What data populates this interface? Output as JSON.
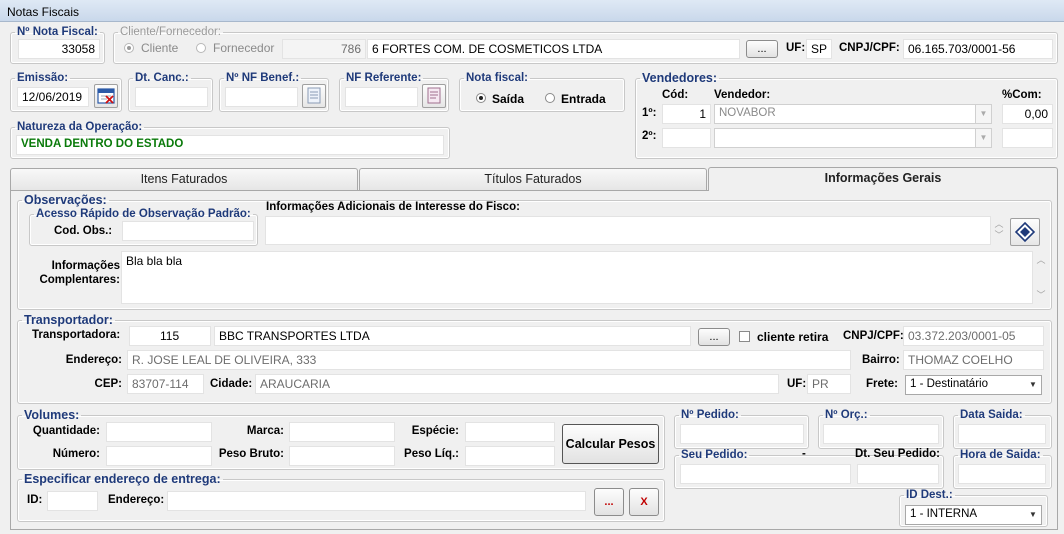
{
  "window": {
    "title": "Notas Fiscais"
  },
  "nota": {
    "label": "Nº Nota Fiscal:",
    "value": "33058"
  },
  "cliente": {
    "legend": "Cliente/Fornecedor:",
    "opt_cliente": "Cliente",
    "opt_fornecedor": "Fornecedor",
    "code": "786",
    "name": "6 FORTES COM. DE COSMETICOS LTDA",
    "browse": "...",
    "uf_label": "UF:",
    "uf_value": "SP",
    "cnpj_label": "CNPJ/CPF:",
    "cnpj_value": "06.165.703/0001-56"
  },
  "emissao": {
    "label": "Emissão:",
    "value": "12/06/2019"
  },
  "dtcanc": {
    "label": "Dt. Canc.:",
    "value": ""
  },
  "nfbenef": {
    "label": "Nº NF Benef.:",
    "value": ""
  },
  "nfref": {
    "label": "NF Referente:",
    "value": ""
  },
  "notafiscal": {
    "label": "Nota fiscal:",
    "opt_saida": "Saída",
    "opt_entrada": "Entrada"
  },
  "vendedores": {
    "legend": "Vendedores:",
    "cod_header": "Cód:",
    "vend_header": "Vendedor:",
    "com_header": "%Com:",
    "row1_label": "1º:",
    "row1_cod": "1",
    "row1_name": "NOVABOR",
    "row1_com": "0,00",
    "row2_label": "2º:"
  },
  "natureza": {
    "label": "Natureza da Operação:",
    "value": "VENDA DENTRO DO ESTADO"
  },
  "tabs": [
    {
      "label": "Itens Faturados"
    },
    {
      "label": "Títulos Faturados"
    },
    {
      "label": "Informações Gerais"
    }
  ],
  "observacoes": {
    "legend": "Observações:",
    "acesso_legend": "Acesso Rápido de Observação Padrão:",
    "cod_label": "Cod. Obs.:",
    "fisco_label": "Informações Adicionais de Interesse do Fisco:",
    "compl_label_1": "Informações",
    "compl_label_2": "Complentares:",
    "compl_value": "Bla bla bla"
  },
  "transportador": {
    "legend": "Transportador:",
    "transp_label": "Transportadora:",
    "transp_code": "115",
    "transp_name": "BBC TRANSPORTES LTDA",
    "browse": "...",
    "retira_label": "cliente retira",
    "cnpj_label": "CNPJ/CPF:",
    "cnpj_value": "03.372.203/0001-05",
    "endereco_label": "Endereço:",
    "endereco_value": "R. JOSE LEAL DE OLIVEIRA, 333",
    "bairro_label": "Bairro:",
    "bairro_value": "THOMAZ COELHO",
    "cep_label": "CEP:",
    "cep_value": "83707-114",
    "cidade_label": "Cidade:",
    "cidade_value": "ARAUCARIA",
    "uf_label": "UF:",
    "uf_value": "PR",
    "frete_label": "Frete:",
    "frete_value": "1 - Destinatário"
  },
  "volumes": {
    "legend": "Volumes:",
    "quantidade": "Quantidade:",
    "marca": "Marca:",
    "especie": "Espécie:",
    "numero": "Número:",
    "peso_bruto": "Peso Bruto:",
    "peso_liq": "Peso Líq.:",
    "calc_button": "Calcular Pesos"
  },
  "pedido": {
    "npedido": "Nº Pedido:",
    "norc": "Nº Orç.:",
    "data_saida": "Data Saida:",
    "seu_pedido": "Seu Pedido:",
    "dash": "-",
    "dt_seu_pedido": "Dt. Seu Pedido:",
    "hora_saida": "Hora de Saida:"
  },
  "entrega": {
    "legend": "Especificar endereço de entrega:",
    "id_label": "ID:",
    "endereco_label": "Endereço:",
    "browse": "...",
    "clear": "X"
  },
  "iddest": {
    "label": "ID Dest.:",
    "value": "1 - INTERNA"
  }
}
